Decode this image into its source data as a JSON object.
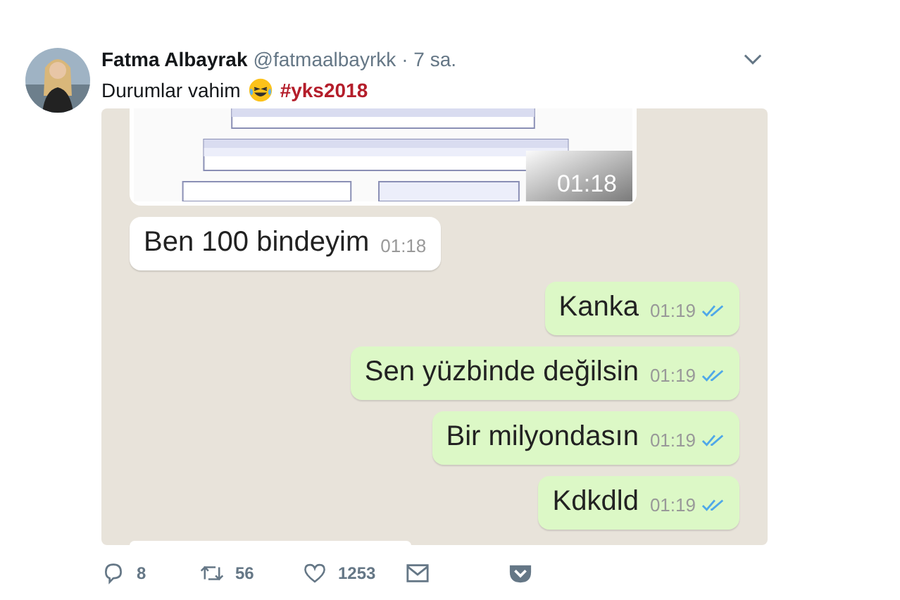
{
  "tweet": {
    "name": "Fatma Albayrak",
    "handle": "@fatmaalbayrkk",
    "time": "· 7 sa.",
    "text": "Durumlar vahim",
    "hashtag": "#yks2018"
  },
  "chat": [
    {
      "outgoing": false,
      "time": "01:18"
    },
    {
      "kind": "text",
      "outgoing": false,
      "text": "Ben 100 bindeyim",
      "time": "01:18"
    },
    {
      "kind": "text",
      "outgoing": true,
      "text": "Kanka",
      "time": "01:19",
      "read": true
    },
    {
      "kind": "text",
      "outgoing": true,
      "text": "Sen yüzbinde değilsin",
      "time": "01:19",
      "read": true
    },
    {
      "kind": "text",
      "outgoing": true,
      "text": "Bir milyondasın",
      "time": "01:19",
      "read": true
    },
    {
      "kind": "text",
      "outgoing": true,
      "text": "Kdkdld",
      "time": "01:19",
      "read": true
    }
  ],
  "actions": [
    {
      "kind": "reply",
      "count": "8"
    },
    {
      "kind": "retweet",
      "count": "56"
    },
    {
      "kind": "like",
      "count": "1253"
    },
    {
      "kind": "message"
    },
    {
      "kind": "pocket"
    }
  ]
}
